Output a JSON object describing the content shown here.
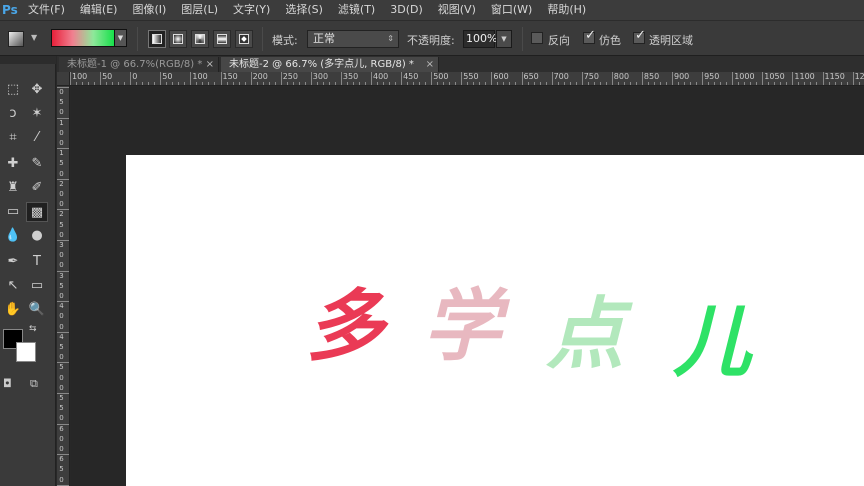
{
  "app": {
    "logo": "Ps"
  },
  "menu": [
    "文件(F)",
    "编辑(E)",
    "图像(I)",
    "图层(L)",
    "文字(Y)",
    "选择(S)",
    "滤镜(T)",
    "3D(D)",
    "视图(V)",
    "窗口(W)",
    "帮助(H)"
  ],
  "options": {
    "gradient_colors": [
      "#e8203a",
      "#f08090",
      "#8ee89a",
      "#17e04a"
    ],
    "mode_label": "模式:",
    "mode_value": "正常",
    "opacity_label": "不透明度:",
    "opacity_value": "100%",
    "reverse_label": "反向",
    "dither_label": "仿色",
    "transparency_label": "透明区域",
    "reverse_checked": false,
    "dither_checked": true,
    "transparency_checked": true
  },
  "tabs": [
    {
      "label": "未标题-1 @ 66.7%(RGB/8) *",
      "close": "×",
      "active": false
    },
    {
      "label": "未标题-2 @ 66.7% (多字点儿, RGB/8) *",
      "close": "×",
      "active": true
    }
  ],
  "ruler_top_labels": [
    "100",
    "50",
    "0",
    "50",
    "100",
    "150",
    "200",
    "250",
    "300",
    "350",
    "400",
    "450",
    "500",
    "550",
    "600",
    "650",
    "700",
    "750",
    "800",
    "850",
    "900",
    "950",
    "1000",
    "1050",
    "1100",
    "1150",
    "12"
  ],
  "ruler_left_labels": [
    "0",
    "5",
    "0",
    "1",
    "0",
    "0",
    "1",
    "5",
    "0",
    "2",
    "0",
    "0",
    "2",
    "5",
    "0",
    "3",
    "0",
    "0",
    "3",
    "5",
    "0",
    "4",
    "0",
    "0",
    "4",
    "5",
    "0",
    "5",
    "0",
    "0",
    "5",
    "5",
    "0",
    "6",
    "0",
    "0",
    "6",
    "5",
    "0"
  ],
  "canvas_text": [
    {
      "char": "多",
      "color": "#ea3a55"
    },
    {
      "char": "学",
      "color": "#e8b8c0"
    },
    {
      "char": "点",
      "color": "#b2e8bc"
    },
    {
      "char": "儿",
      "color": "#2ee266"
    }
  ],
  "icons": {
    "marquee": "⬚",
    "move": "✥",
    "lasso": "ↄ",
    "magic_wand": "✶",
    "crop": "⌗",
    "eyedropper": "⁄",
    "healing": "✚",
    "brush": "✎",
    "stamp": "♜",
    "history_brush": "✐",
    "eraser": "▭",
    "gradient": "▩",
    "blur": "💧",
    "dodge": "●",
    "pen": "✒",
    "type": "T",
    "path_select": "↖",
    "shape": "▭",
    "hand": "✋",
    "zoom": "🔍",
    "swap": "⇆",
    "quickmask": "◘",
    "screenmode": "⧉"
  }
}
